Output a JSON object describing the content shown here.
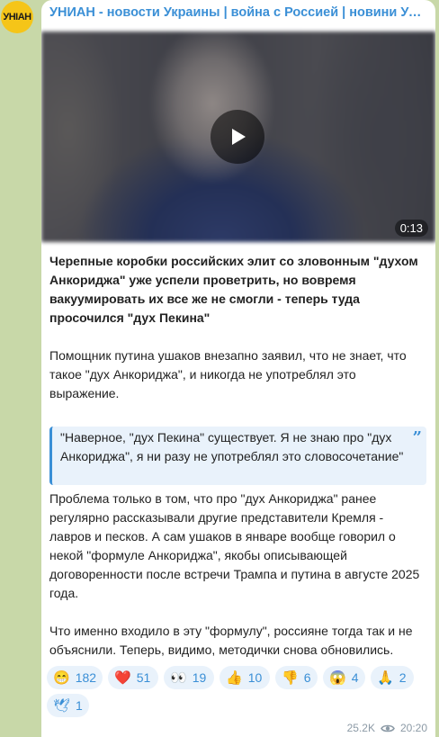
{
  "channel": {
    "avatar_text": "УНІАН",
    "title": "УНИАН - новости Украины | война с Россией | новини України | Україна"
  },
  "video": {
    "duration": "0:13"
  },
  "post": {
    "lead": "Черепные коробки российских элит со зловонным \"духом Анкориджа\" уже успели проветрить, но вовремя вакуумировать их все же не смогли - теперь туда просочился \"дух Пекина\"",
    "para1": "Помощник путина ушаков внезапно заявил, что не знает, что такое \"дух Анкориджа\", и никогда не употреблял это выражение.",
    "quote": "\"Наверное, \"дух Пекина\" существует. Я не знаю про \"дух Анкориджа\", я ни разу не употреблял это словосочетание\"",
    "para2": "Проблема только в том, что про \"дух Анкориджа\" ранее регулярно рассказывали другие представители Кремля - лавров и песков. А сам ушаков в январе вообще говорил о некой \"формуле Анкориджа\", якобы описывающей договоренности после встречи Трампа и путина в августе 2025 года.",
    "para3": "Что именно входило в эту \"формулу\", россияне тогда так и не объяснили. Теперь, видимо, методички снова обновились."
  },
  "reactions": [
    {
      "emoji": "😁",
      "count": "182",
      "name": "reaction-grin"
    },
    {
      "emoji": "❤️",
      "count": "51",
      "name": "reaction-heart"
    },
    {
      "emoji": "👀",
      "count": "19",
      "name": "reaction-eyes"
    },
    {
      "emoji": "👍",
      "count": "10",
      "name": "reaction-thumbs-up"
    },
    {
      "emoji": "👎",
      "count": "6",
      "name": "reaction-thumbs-down"
    },
    {
      "emoji": "😱",
      "count": "4",
      "name": "reaction-scream"
    },
    {
      "emoji": "🙏",
      "count": "2",
      "name": "reaction-pray"
    },
    {
      "emoji": "🕊",
      "count": "1",
      "name": "reaction-dove"
    }
  ],
  "meta": {
    "views": "25.2K",
    "time": "20:20"
  },
  "colors": {
    "accent": "#3a8fd6",
    "avatar": "#f5c518",
    "background": "#c8d8a8"
  }
}
